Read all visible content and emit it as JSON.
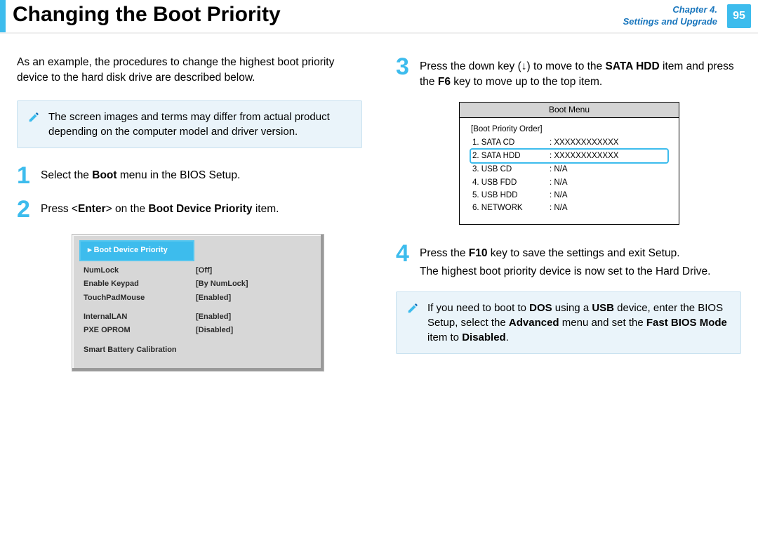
{
  "header": {
    "title": "Changing the Boot Priority",
    "chapter_line1": "Chapter 4.",
    "chapter_line2": "Settings and Upgrade",
    "page_number": "95"
  },
  "left": {
    "intro": "As an example, the procedures to change the highest boot priority device to the hard disk drive are described below.",
    "note": "The screen images and terms may differ from actual product depending on the computer model and driver version.",
    "step1_pre": "Select the ",
    "step1_bold": "Boot",
    "step1_post": " menu in the BIOS Setup.",
    "step2_pre": "Press <",
    "step2_b1": "Enter",
    "step2_mid": "> on the ",
    "step2_b2": "Boot Device Priority",
    "step2_post": " item.",
    "bios": {
      "priority": "Boot Device Priority",
      "rows1": [
        {
          "label": "NumLock",
          "value": "[Off]"
        },
        {
          "label": "Enable Keypad",
          "value": "[By NumLock]"
        },
        {
          "label": "TouchPadMouse",
          "value": "[Enabled]"
        }
      ],
      "rows2": [
        {
          "label": "InternalLAN",
          "value": "[Enabled]"
        },
        {
          "label": "PXE OPROM",
          "value": "[Disabled]"
        }
      ],
      "calib": "Smart Battery Calibration"
    }
  },
  "right": {
    "step3_pre": "Press the down key (↓) to move to the ",
    "step3_b1": "SATA HDD",
    "step3_mid": " item and press the ",
    "step3_b2": "F6",
    "step3_post": " key to move up to the top item.",
    "boot_menu": {
      "title": "Boot Menu",
      "group": "[Boot Priority Order]",
      "items": [
        {
          "dev": "1. SATA CD",
          "val": "XXXXXXXXXXXX"
        },
        {
          "dev": "2. SATA HDD",
          "val": "XXXXXXXXXXXX"
        },
        {
          "dev": "3. USB CD",
          "val": "N/A"
        },
        {
          "dev": "4. USB FDD",
          "val": "N/A"
        },
        {
          "dev": "5. USB HDD",
          "val": "N/A"
        },
        {
          "dev": "6. NETWORK",
          "val": "N/A"
        }
      ]
    },
    "step4_pre": "Press the ",
    "step4_b1": "F10",
    "step4_mid": " key to save the settings and exit Setup.",
    "step4_line2": "The highest boot priority device is now set to the Hard Drive.",
    "note2_pre": "If you need to boot to ",
    "note2_b1": "DOS",
    "note2_mid1": " using a ",
    "note2_b2": "USB",
    "note2_mid2": " device, enter the BIOS Setup, select the ",
    "note2_b3": "Advanced",
    "note2_mid3": " menu and set the ",
    "note2_b4": "Fast BIOS Mode",
    "note2_mid4": " item to ",
    "note2_b5": "Disabled",
    "note2_post": "."
  }
}
